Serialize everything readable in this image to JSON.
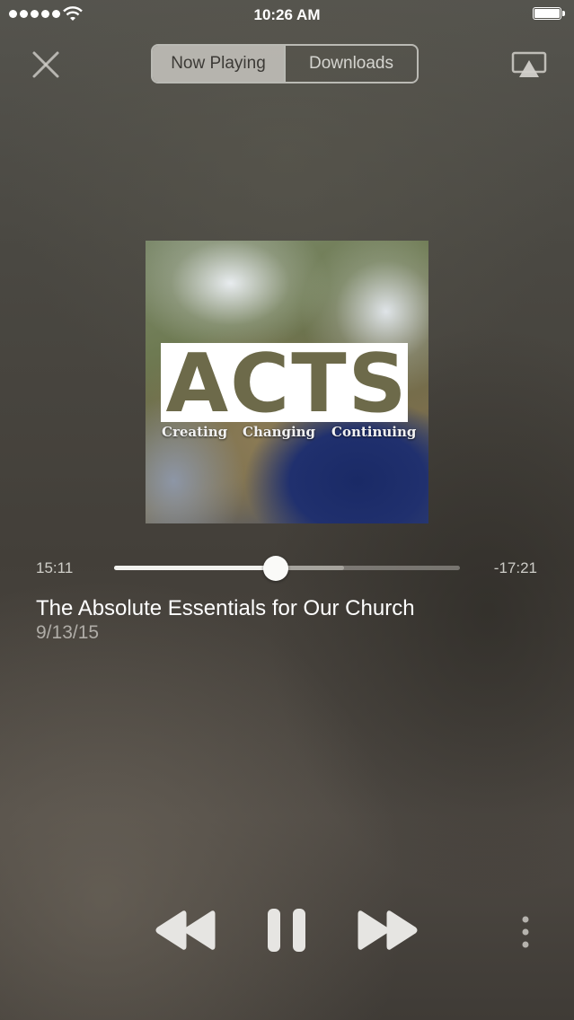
{
  "status_bar": {
    "time": "10:26 AM",
    "signal_bars": 5,
    "battery_level": 1.0
  },
  "header": {
    "close_icon": "close-icon",
    "tabs": [
      {
        "label": "Now Playing",
        "selected": true
      },
      {
        "label": "Downloads",
        "selected": false
      }
    ],
    "airplay_icon": "airplay-icon"
  },
  "artwork": {
    "title_text": "ACTS",
    "taglines": [
      "Creating",
      "Changing",
      "Continuing"
    ]
  },
  "player": {
    "elapsed": "15:11",
    "remaining": "-17:21",
    "progress_fraction": 0.467,
    "buffered_fraction": 0.665
  },
  "track": {
    "title": "The Absolute Essentials for Our Church",
    "date": "9/13/15"
  },
  "controls": {
    "rewind_icon": "rewind-icon",
    "pause_icon": "pause-icon",
    "forward_icon": "fast-forward-icon",
    "more_icon": "more-vertical-icon"
  },
  "colors": {
    "control_light": "#e6e5e2",
    "accent_active_segment": "#c8c6c0"
  }
}
